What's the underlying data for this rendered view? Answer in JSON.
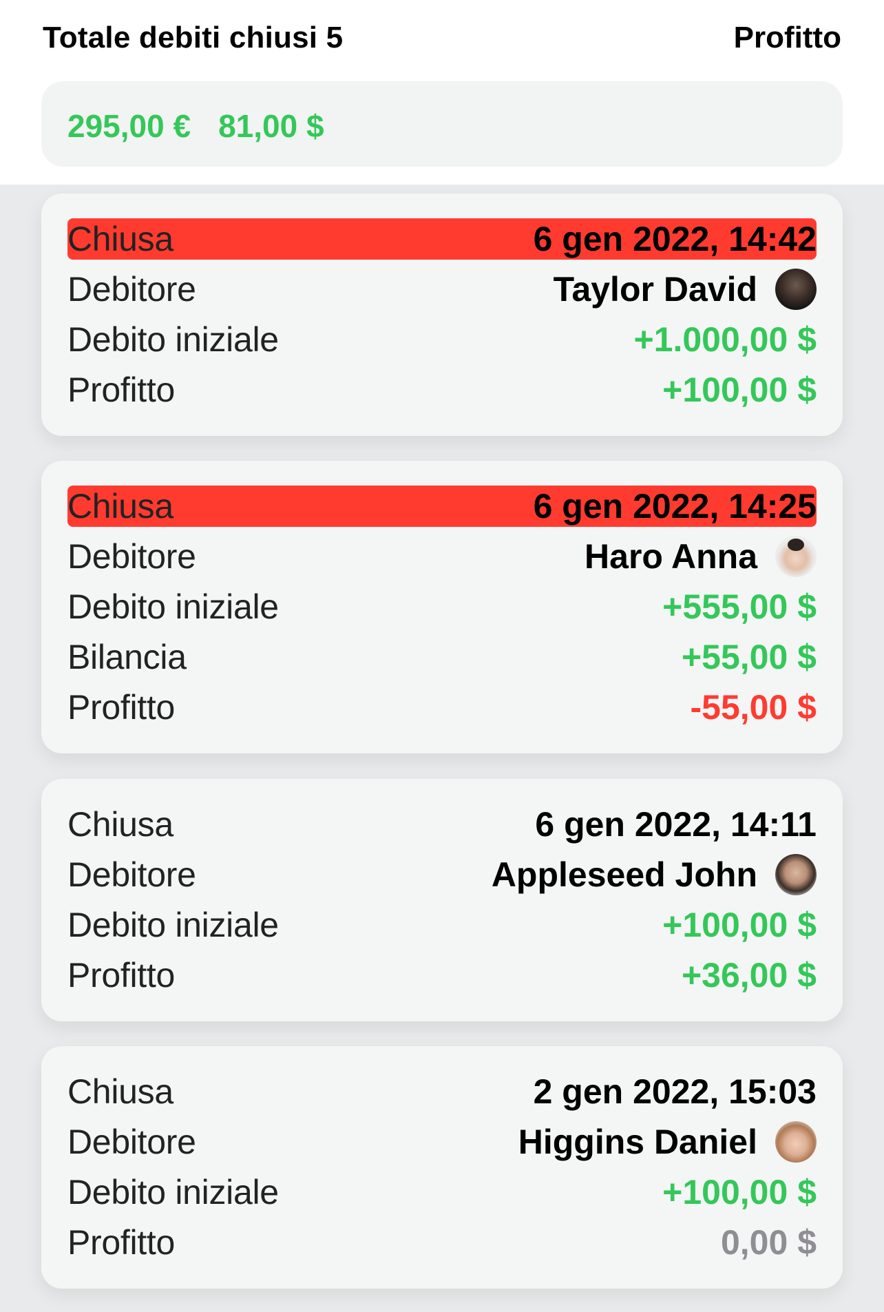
{
  "header": {
    "title": "Totale debiti chiusi 5",
    "right_label": "Profitto"
  },
  "summary": {
    "amounts": [
      "295,00 €",
      "81,00 $"
    ],
    "color": "#34c759"
  },
  "colors": {
    "green": "#34c759",
    "red": "#ff3b30",
    "gray": "#8e8e93",
    "highlight": "#ff3b30"
  },
  "debts": [
    {
      "highlighted": true,
      "status_label": "Chiusa",
      "date": "6 gen 2022, 14:42",
      "debtor_label": "Debitore",
      "debtor": "Taylor David",
      "avatar": "avatar-dark",
      "initial_label": "Debito iniziale",
      "initial": "+1.000,00 $",
      "profit_label": "Profitto",
      "profit": "+100,00 $",
      "profit_color": "green"
    },
    {
      "highlighted": true,
      "status_label": "Chiusa",
      "date": "6 gen 2022, 14:25",
      "debtor_label": "Debitore",
      "debtor": "Haro Anna",
      "avatar": "avatar-woman",
      "initial_label": "Debito iniziale",
      "initial": "+555,00 $",
      "balance_label": "Bilancia",
      "balance": "+55,00 $",
      "profit_label": "Profitto",
      "profit": "-55,00 $",
      "profit_color": "red"
    },
    {
      "highlighted": false,
      "status_label": "Chiusa",
      "date": "6 gen 2022, 14:11",
      "debtor_label": "Debitore",
      "debtor": "Appleseed John",
      "avatar": "avatar-beard",
      "initial_label": "Debito iniziale",
      "initial": "+100,00 $",
      "profit_label": "Profitto",
      "profit": "+36,00 $",
      "profit_color": "green"
    },
    {
      "highlighted": false,
      "status_label": "Chiusa",
      "date": "2 gen 2022, 15:03",
      "debtor_label": "Debitore",
      "debtor": "Higgins Daniel",
      "avatar": "avatar-youth",
      "initial_label": "Debito iniziale",
      "initial": "+100,00 $",
      "profit_label": "Profitto",
      "profit": "0,00 $",
      "profit_color": "gray"
    }
  ]
}
